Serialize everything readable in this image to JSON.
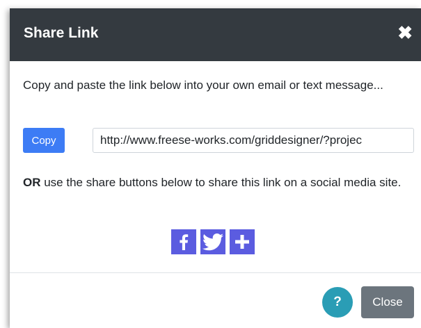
{
  "dialog": {
    "title": "Share Link",
    "close_glyph": "✖"
  },
  "body": {
    "intro_text": "Copy and paste the link below into your own email or text message...",
    "copy_label": "Copy",
    "link_value": "http://www.freese-works.com/griddesigner/?projec",
    "or_bold": "OR",
    "or_rest": " use the share buttons below to share this link on a social media site."
  },
  "social": {
    "buttons": [
      {
        "icon": "facebook-icon"
      },
      {
        "icon": "twitter-icon"
      },
      {
        "icon": "plus-icon"
      }
    ],
    "color": "#5b5ce0"
  },
  "footer": {
    "help_label": "?",
    "close_label": "Close"
  },
  "colors": {
    "header_bg": "#343a40",
    "copy_bg": "#3d7cf5",
    "help_bg": "#2a9db5",
    "close_bg": "#6c757d"
  }
}
